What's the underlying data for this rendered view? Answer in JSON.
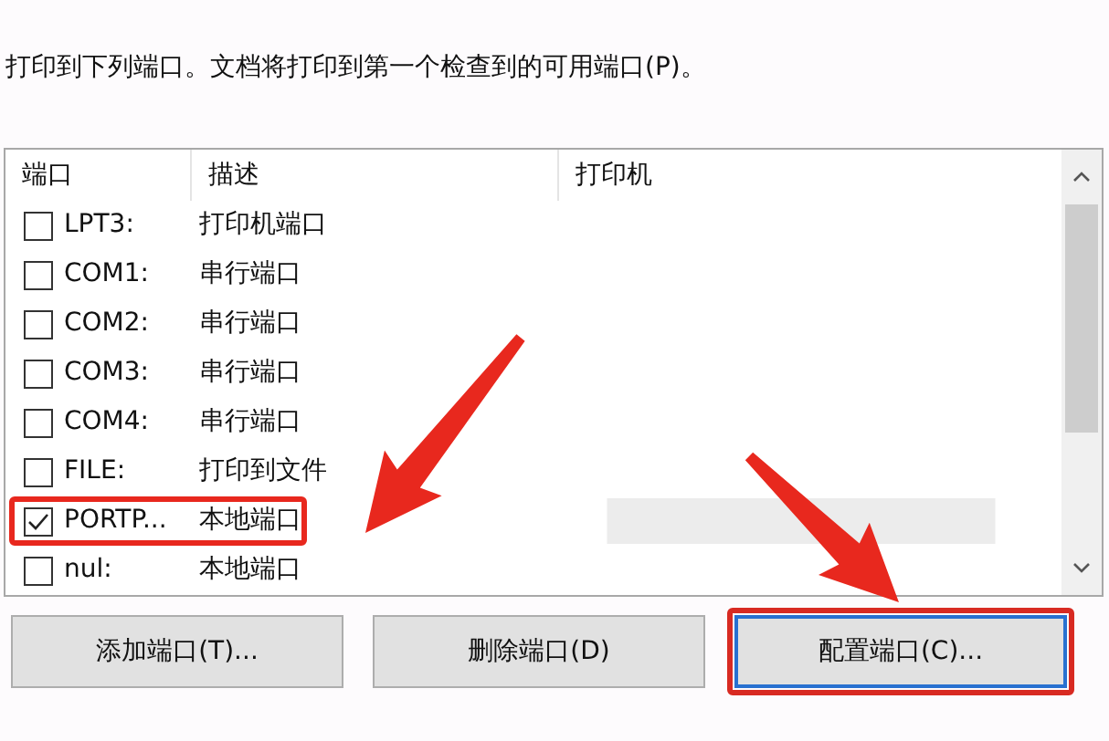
{
  "instruction": "打印到下列端口。文档将打印到第一个检查到的可用端口(P)。",
  "columns": [
    "端口",
    "描述",
    "打印机"
  ],
  "rows": [
    {
      "port": "LPT3:",
      "description": "打印机端口",
      "checked": false,
      "annotated": false,
      "blurred": false
    },
    {
      "port": "COM1:",
      "description": "串行端口",
      "checked": false,
      "annotated": false,
      "blurred": false
    },
    {
      "port": "COM2:",
      "description": "串行端口",
      "checked": false,
      "annotated": false,
      "blurred": false
    },
    {
      "port": "COM3:",
      "description": "串行端口",
      "checked": false,
      "annotated": false,
      "blurred": false
    },
    {
      "port": "COM4:",
      "description": "串行端口",
      "checked": false,
      "annotated": false,
      "blurred": false
    },
    {
      "port": "FILE:",
      "description": "打印到文件",
      "checked": false,
      "annotated": false,
      "blurred": false
    },
    {
      "port": "PORTP...",
      "description": "本地端口",
      "checked": true,
      "annotated": true,
      "blurred": true
    },
    {
      "port": "nul:",
      "description": "本地端口",
      "checked": false,
      "annotated": false,
      "blurred": false
    }
  ],
  "buttons": [
    {
      "label": "添加端口(T)...",
      "focused": false,
      "annotated": false
    },
    {
      "label": "删除端口(D)",
      "focused": false,
      "annotated": false
    },
    {
      "label": "配置端口(C)...",
      "focused": true,
      "annotated": true
    }
  ]
}
